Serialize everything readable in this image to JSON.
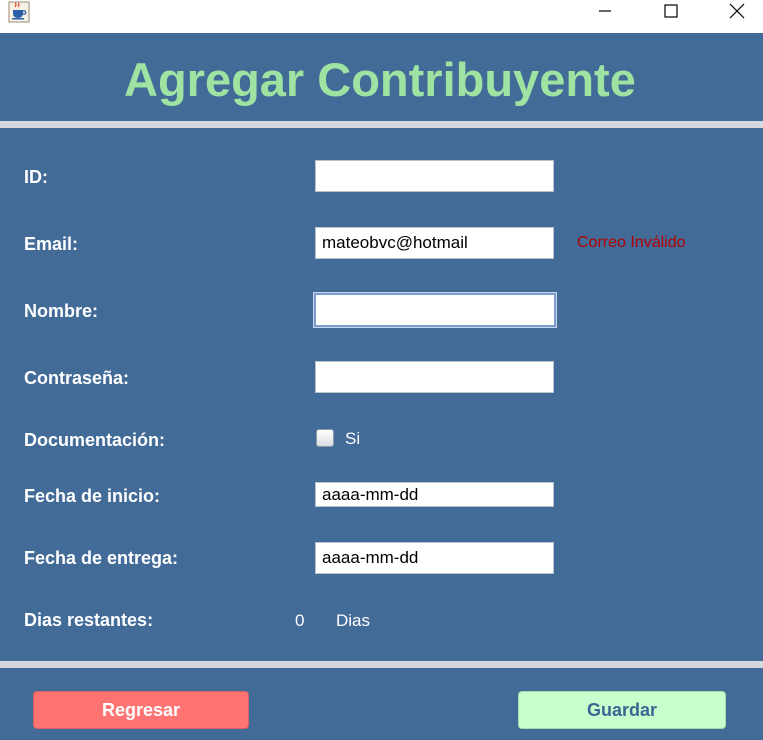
{
  "window": {
    "minimize_icon": "minimize-icon",
    "maximize_icon": "maximize-icon",
    "close_icon": "close-icon",
    "app_icon": "java-cup-icon"
  },
  "header": {
    "title": "Agregar Contribuyente"
  },
  "form": {
    "id": {
      "label": "ID:",
      "value": ""
    },
    "email": {
      "label": "Email:",
      "value": "mateobvc@hotmail",
      "error": "Correo Inválido"
    },
    "nombre": {
      "label": "Nombre:",
      "value": ""
    },
    "contrasena": {
      "label": "Contraseña:",
      "value": ""
    },
    "documentacion": {
      "label": "Documentación:",
      "checkbox_label": "Si",
      "checked": false
    },
    "fecha_inicio": {
      "label": "Fecha de inicio:",
      "value": "aaaa-mm-dd"
    },
    "fecha_entrega": {
      "label": "Fecha de entrega:",
      "value": "aaaa-mm-dd"
    },
    "dias_restantes": {
      "label": "Dias restantes:",
      "value": "0",
      "unit": "Dias"
    }
  },
  "buttons": {
    "back": "Regresar",
    "save": "Guardar"
  },
  "colors": {
    "background": "#426b98",
    "title": "#9fe3a2",
    "error": "#b30000",
    "back_button": "#ff7373",
    "save_button": "#c9ffcc",
    "save_text": "#3e6594"
  }
}
